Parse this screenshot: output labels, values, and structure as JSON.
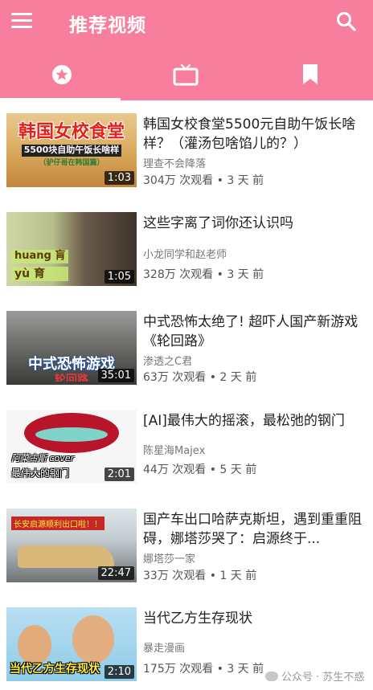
{
  "app_bar": {
    "title": "推荐视频",
    "menu_icon": "hamburger-menu-icon",
    "search_icon": "search-icon",
    "background": "#f77f9d"
  },
  "tabs": [
    {
      "icon": "star-circle-icon",
      "selected": true
    },
    {
      "icon": "tv-icon",
      "selected": false
    },
    {
      "icon": "bookmark-icon",
      "selected": false
    }
  ],
  "videos": [
    {
      "thumb_text": "韩国女校食堂",
      "thumb_sub": "5500块自助午饭长啥样",
      "thumb_sub2": "（驴仔哥在韩国篇）",
      "duration": "1:03",
      "title": "韩国女校食堂5500元自助午饭长啥样？（灌汤包啥馅儿的？）",
      "channel": "理查不会降落",
      "meta": "304万 次观看 • 3 天 前"
    },
    {
      "thumb_text": "yù 育",
      "thumb_sub": "huang 肓",
      "duration": "1:05",
      "title": "这些字离了词你还认识吗",
      "channel": "小龙同学和赵老师",
      "meta": "328万 次观看 • 3 天 前"
    },
    {
      "thumb_text": "中式恐怖游戏",
      "thumb_sub": "轮回路",
      "duration": "35:01",
      "title": "中式恐怖太绝了! 超吓人国产新游戏《轮回路》",
      "channel": "渗透之C君",
      "meta": "63万 次观看 • 2 天 前"
    },
    {
      "thumb_text": "阿菜古斯 cover",
      "thumb_sub": "最伟大的钢门",
      "duration": "2:01",
      "title": "[AI]最伟大的摇滚，最松弛的钢门",
      "channel": "陈星海Majex",
      "meta": "44万 次观看 • 5 天 前"
    },
    {
      "thumb_text": "长安启源顺利出口啦！！",
      "duration": "22:47",
      "title": "国产车出口哈萨克斯坦，遇到重重阻碍，娜塔莎哭了：启源终于...",
      "channel": "娜塔莎一家",
      "meta": "33万 次观看 • 1 天 前"
    },
    {
      "thumb_text": "当代乙方生存现状",
      "duration": "2:10",
      "title": "当代乙方生存现状",
      "channel": "暴走漫画",
      "meta": "175万 次观看 • 3 天 前"
    }
  ],
  "watermark": "公众号 · 苏生不惑"
}
